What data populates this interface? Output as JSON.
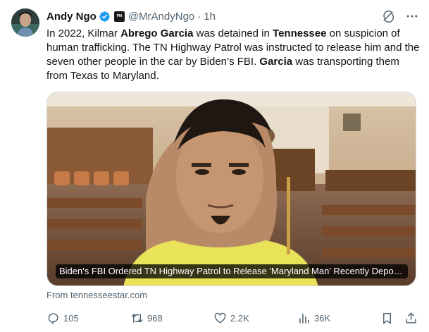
{
  "tweet": {
    "author": {
      "display_name": "Andy Ngo",
      "handle": "@MrAndyNgo",
      "affiliate_badge": "PM",
      "verified_color": "#1d9bf0"
    },
    "separator": "·",
    "timestamp": "1h",
    "text": {
      "p1": "In 2022, Kilmar ",
      "b1": "Abrego Garcia",
      "p2": " was detained in ",
      "b2": "Tennessee",
      "p3": " on suspicion of human trafficking. The TN Highway Patrol was instructed to release him and the seven other people in the car by Biden’s FBI. ",
      "b3": "Garcia",
      "p4": " was transporting them from Texas to Maryland."
    },
    "media": {
      "caption": "Biden's FBI Ordered TN Highway Patrol to Release 'Maryland Man' Recently Deported to El Salvador"
    },
    "link_source": "From tennesseestar.com",
    "actions": {
      "reply_count": "105",
      "retweet_count": "968",
      "like_count": "2.2K",
      "view_count": "36K"
    },
    "icons": {
      "header": [
        "grok-icon",
        "more-icon"
      ],
      "actions": [
        "reply-icon",
        "retweet-icon",
        "like-icon",
        "views-icon",
        "bookmark-icon",
        "share-icon"
      ]
    },
    "colors": {
      "text": "#0f1419",
      "secondary": "#536471",
      "accent": "#1d9bf0"
    }
  }
}
